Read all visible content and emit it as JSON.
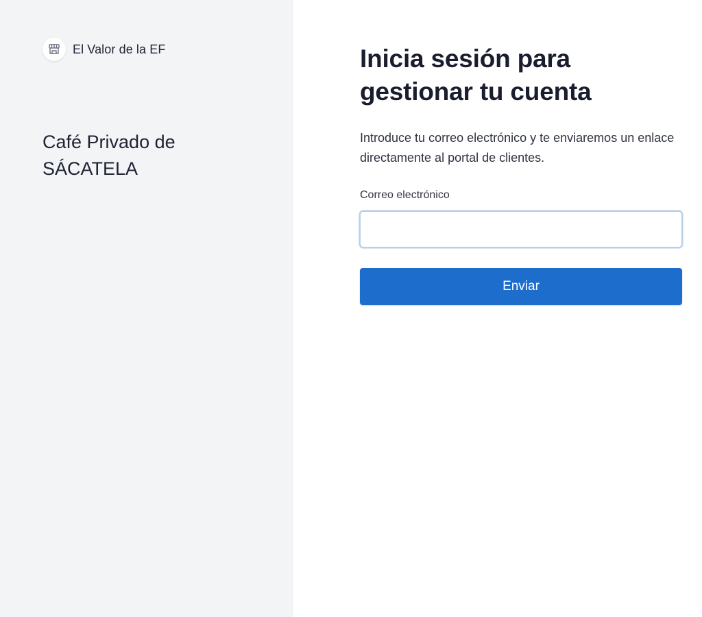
{
  "brand": {
    "name": "El Valor de la EF",
    "logo_icon": "storefront-icon"
  },
  "business": {
    "name": "Café Privado de SÁCATELA"
  },
  "login": {
    "title": "Inicia sesión para gestionar tu cuenta",
    "description": "Introduce tu correo electrónico y te enviaremos un enlace directamente al portal de clientes.",
    "email_label": "Correo electrónico",
    "email_value": "",
    "submit_label": "Enviar"
  },
  "colors": {
    "accent": "#1d6dcc",
    "left_panel_bg": "#f3f4f6",
    "text_primary": "#1a1d2e"
  }
}
